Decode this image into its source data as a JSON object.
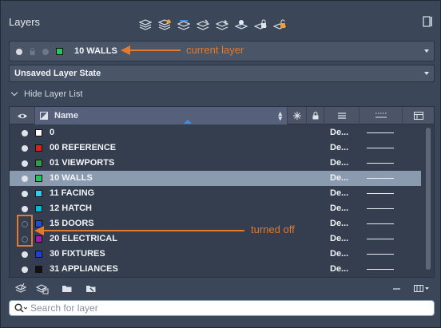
{
  "panel": {
    "title": "Layers"
  },
  "toolbar": {
    "icons": [
      "new-layer-icon",
      "new-layer-vp-frozen-icon",
      "layer-properties-icon",
      "isolate-icon",
      "freeze-icon",
      "turn-off-icon",
      "lock-icon",
      "make-current-icon"
    ]
  },
  "current_layer": {
    "name": "10 WALLS",
    "color": "#22c55e"
  },
  "layer_state": {
    "value": "Unsaved Layer State"
  },
  "list_toggle": {
    "label": "Hide Layer List"
  },
  "table": {
    "columns": {
      "name": "Name"
    },
    "rows": [
      {
        "name": "0",
        "color": "#ffffff",
        "on": true,
        "linetype": "De...",
        "selected": false
      },
      {
        "name": "00 REFERENCE",
        "color": "#e11d1d",
        "on": true,
        "linetype": "De...",
        "selected": false
      },
      {
        "name": "01 VIEWPORTS",
        "color": "#2ea043",
        "on": true,
        "linetype": "De...",
        "selected": false
      },
      {
        "name": "10 WALLS",
        "color": "#22c55e",
        "on": true,
        "linetype": "De...",
        "selected": true
      },
      {
        "name": "11 FACING",
        "color": "#22d3ee",
        "on": true,
        "linetype": "De...",
        "selected": false
      },
      {
        "name": "12 HATCH",
        "color": "#06b6d4",
        "on": true,
        "linetype": "De...",
        "selected": false
      },
      {
        "name": "15 DOORS",
        "color": "#1d4ed8",
        "on": false,
        "linetype": "De...",
        "selected": false
      },
      {
        "name": "20 ELECTRICAL",
        "color": "#a21caf",
        "on": false,
        "linetype": "De...",
        "selected": false
      },
      {
        "name": "30 FIXTURES",
        "color": "#1e3fd8",
        "on": true,
        "linetype": "De...",
        "selected": false
      },
      {
        "name": "31 APPLIANCES",
        "color": "#111111",
        "on": true,
        "linetype": "De...",
        "selected": false
      }
    ]
  },
  "search": {
    "placeholder": "Search for layer"
  },
  "annotations": {
    "current_layer": "current layer",
    "turned_off": "turned off",
    "color": "#e07a2e"
  }
}
